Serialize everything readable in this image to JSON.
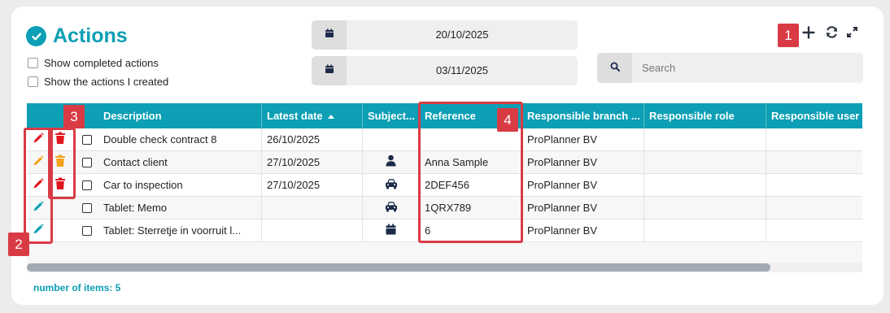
{
  "header": {
    "title": "Actions"
  },
  "filters": {
    "show_completed": "Show completed actions",
    "show_created": "Show the actions I created",
    "date_from": "20/10/2025",
    "date_to": "03/11/2025",
    "search_placeholder": "Search"
  },
  "table": {
    "columns": [
      "Description",
      "Latest date",
      "Subject...",
      "Reference",
      "Responsible branch ...",
      "Responsible role",
      "Responsible user"
    ],
    "rows": [
      {
        "description": "Double check contract 8",
        "latest_date": "26/10/2025",
        "subject_icon": "",
        "reference": "",
        "branch": "ProPlanner BV",
        "edit_color": "#e0161e",
        "delete_color": "#e0161e"
      },
      {
        "description": "Contact client",
        "latest_date": "27/10/2025",
        "subject_icon": "person-icon",
        "reference": "Anna Sample",
        "branch": "ProPlanner BV",
        "edit_color": "#f4a41c",
        "delete_color": "#f4a41c"
      },
      {
        "description": "Car to inspection",
        "latest_date": "27/10/2025",
        "subject_icon": "car-icon",
        "reference": "2DEF456",
        "branch": "ProPlanner BV",
        "edit_color": "#e0161e",
        "delete_color": "#e0161e"
      },
      {
        "description": "Tablet: Memo",
        "latest_date": "",
        "subject_icon": "car-icon",
        "reference": "1QRX789",
        "branch": "ProPlanner BV",
        "edit_color": "#0c9fb5",
        "delete_color": ""
      },
      {
        "description": "Tablet: Sterretje in voorruit l...",
        "latest_date": "",
        "subject_icon": "calendar-icon",
        "reference": "6",
        "branch": "ProPlanner BV",
        "edit_color": "#0c9fb5",
        "delete_color": ""
      }
    ]
  },
  "footer": {
    "count_label": "number of items: 5"
  },
  "annotations": [
    "1",
    "2",
    "3",
    "4"
  ],
  "colors": {
    "accent": "#0c9fb5",
    "annotation": "#d93b45",
    "warning": "#f4a41c",
    "danger": "#e0161e"
  }
}
